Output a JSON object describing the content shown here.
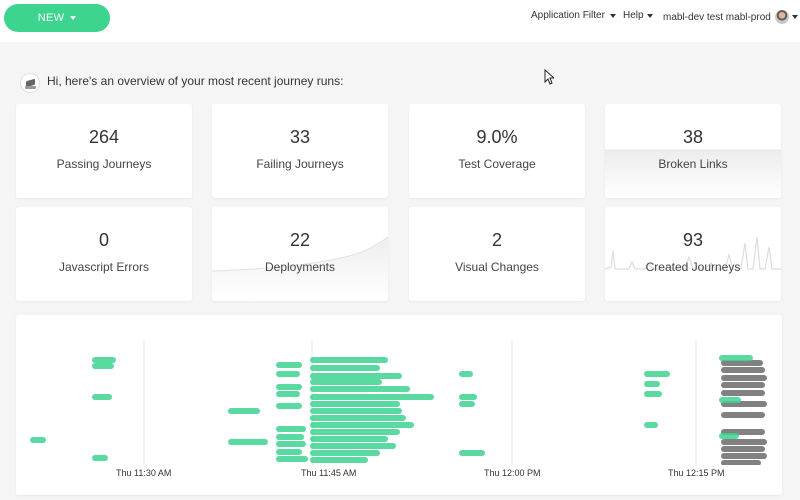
{
  "header": {
    "new_label": "NEW",
    "app_filter_label": "Application Filter",
    "help_label": "Help",
    "user_label": "mabl-dev test mabl-prod"
  },
  "greeting": "Hi, here's an overview of your most recent journey runs:",
  "stats": [
    {
      "value": "264",
      "label": "Passing Journeys"
    },
    {
      "value": "33",
      "label": "Failing Journeys"
    },
    {
      "value": "9.0%",
      "label": "Test Coverage"
    },
    {
      "value": "38",
      "label": "Broken Links"
    },
    {
      "value": "0",
      "label": "Javascript Errors"
    },
    {
      "value": "22",
      "label": "Deployments"
    },
    {
      "value": "2",
      "label": "Visual Changes"
    },
    {
      "value": "93",
      "label": "Created Journeys"
    }
  ],
  "timeline": {
    "ticks": [
      "Thu 11:30 AM",
      "Thu 11:45 AM",
      "Thu 12:00 PM",
      "Thu 12:15 PM"
    ],
    "colors": {
      "pass": "#3dd490",
      "running": "#6b6b6b"
    }
  }
}
